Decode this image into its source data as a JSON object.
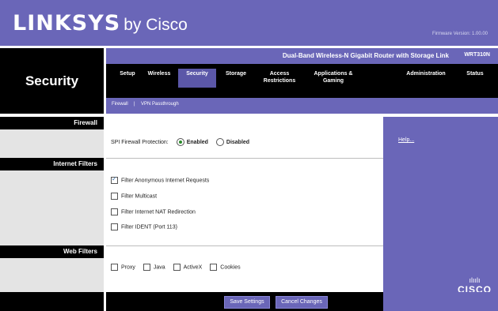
{
  "brand": {
    "linksys": "LINKSYS",
    "by": "by Cisco"
  },
  "firmware": "Firmware Version: 1.00.00",
  "product_name": "Dual-Band Wireless-N Gigabit Router with Storage Link",
  "model": "WRT310N",
  "section_title": "Security",
  "tabs": [
    {
      "label": "Setup"
    },
    {
      "label": "Wireless"
    },
    {
      "label": "Security"
    },
    {
      "label": "Storage"
    },
    {
      "label": "Access Restrictions"
    },
    {
      "label": "Applications & Gaming"
    },
    {
      "label": "Administration"
    },
    {
      "label": "Status"
    }
  ],
  "subtabs": {
    "firewall": "Firewall",
    "divider": "|",
    "vpn": "VPN Passthrough"
  },
  "firewall": {
    "header": "Firewall",
    "spi_label": "SPI Firewall Protection:",
    "enabled": "Enabled",
    "disabled": "Disabled"
  },
  "internet_filters": {
    "header": "Internet Filters",
    "items": [
      {
        "label": "Filter Anonymous Internet Requests",
        "checked": true
      },
      {
        "label": "Filter Multicast",
        "checked": false
      },
      {
        "label": "Filter Internet NAT Redirection",
        "checked": false
      },
      {
        "label": "Filter IDENT (Port 113)",
        "checked": false
      }
    ]
  },
  "web_filters": {
    "header": "Web Filters",
    "proxy": "Proxy",
    "java": "Java",
    "activex": "ActiveX",
    "cookies": "Cookies"
  },
  "help": {
    "link": "Help..."
  },
  "cisco_logo": {
    "bars": "ılıılı",
    "word": "CISCO"
  },
  "buttons": {
    "save": "Save Settings",
    "cancel": "Cancel Changes"
  },
  "colors": {
    "accent": "#6a66b8",
    "dark": "#000000",
    "left_panel": "#e4e4e4"
  }
}
